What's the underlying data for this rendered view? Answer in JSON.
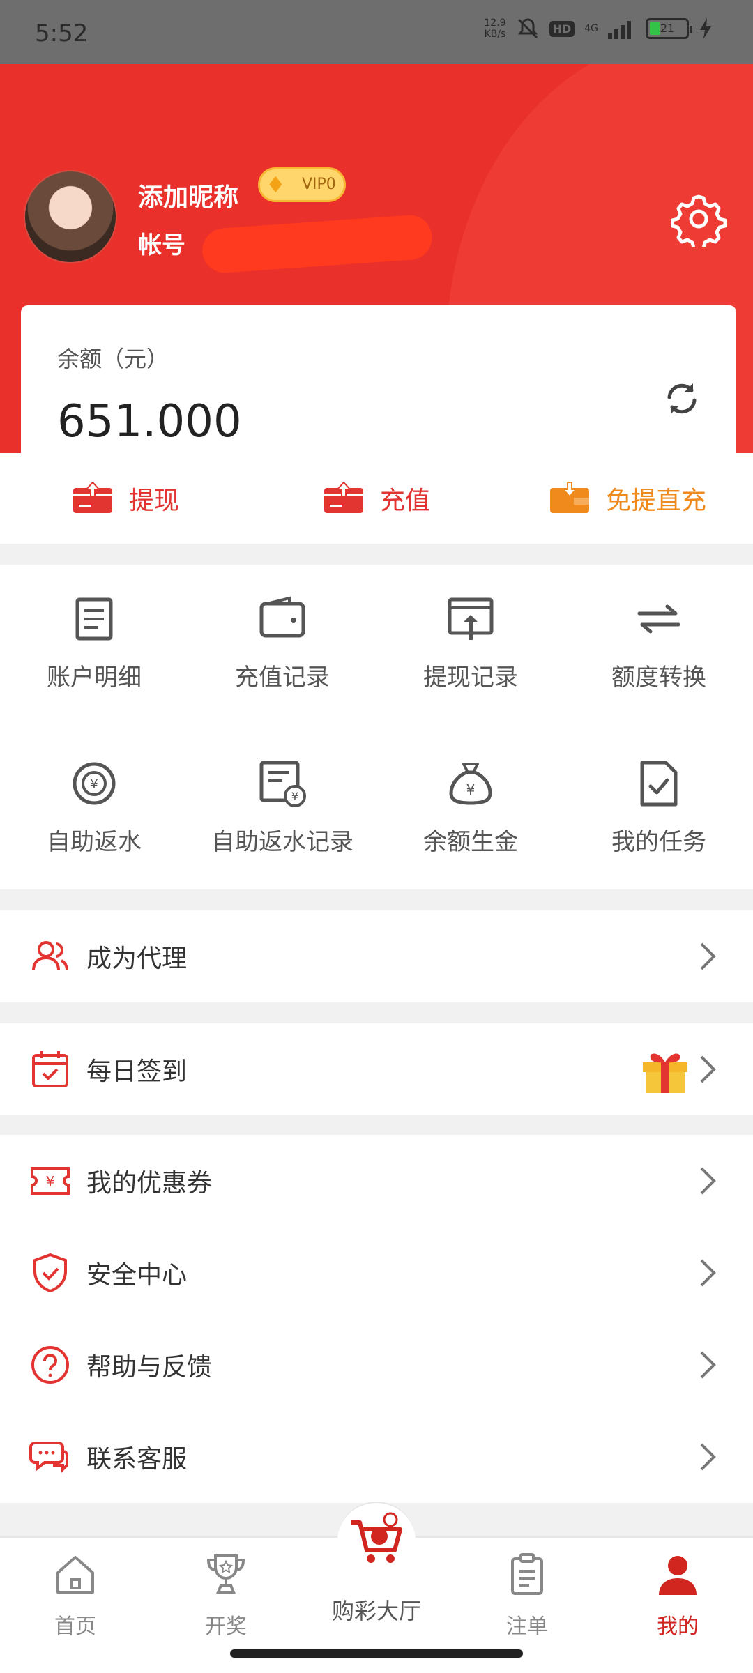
{
  "status_bar": {
    "time": "5:52",
    "net_speed_value": "12.9",
    "net_speed_unit": "KB/s",
    "hd_label": "HD",
    "net_type": "4G",
    "battery": "21"
  },
  "profile": {
    "nickname": "添加昵称",
    "vip_label": "VIP0",
    "account_prefix": "帐号"
  },
  "balance": {
    "label": "余额（元）",
    "value": "651.000"
  },
  "quick_actions": [
    {
      "label": "提现",
      "icon": "withdraw-card-icon"
    },
    {
      "label": "充值",
      "icon": "recharge-card-icon"
    },
    {
      "label": "免提直充",
      "icon": "direct-recharge-wallet-icon"
    }
  ],
  "grid": [
    {
      "label": "账户明细",
      "icon": "document-list-icon"
    },
    {
      "label": "充值记录",
      "icon": "wallet-icon"
    },
    {
      "label": "提现记录",
      "icon": "upload-screen-icon"
    },
    {
      "label": "额度转换",
      "icon": "transfer-arrows-icon"
    },
    {
      "label": "自助返水",
      "icon": "chip-coin-icon"
    },
    {
      "label": "自助返水记录",
      "icon": "receipt-coin-icon"
    },
    {
      "label": "余额生金",
      "icon": "money-bag-icon"
    },
    {
      "label": "我的任务",
      "icon": "task-check-icon"
    }
  ],
  "menu": {
    "agent": "成为代理",
    "checkin": "每日签到",
    "coupons": "我的优惠券",
    "security": "安全中心",
    "help": "帮助与反馈",
    "service": "联系客服"
  },
  "tabs": {
    "home": "首页",
    "lottery_results": "开奖",
    "lobby": "购彩大厅",
    "orders": "注单",
    "mine": "我的"
  },
  "colors": {
    "primary_red": "#e9302b",
    "orange": "#f08a1c",
    "active_tab": "#d0261f"
  }
}
